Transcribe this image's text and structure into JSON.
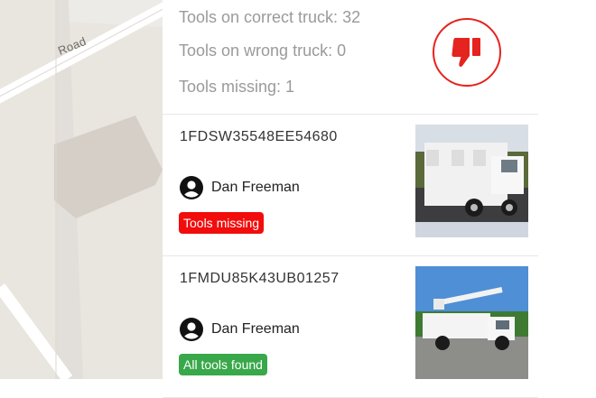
{
  "map": {
    "road_label": "Road"
  },
  "summary": {
    "correct": "Tools on correct truck: 32",
    "wrong": "Tools on wrong truck: 0",
    "missing": "Tools missing: 1",
    "feedback_icon": "thumbs-down-icon",
    "accent": "#e5231f"
  },
  "trucks": [
    {
      "vin": "1FDSW35548EE54680",
      "driver": "Dan Freeman",
      "status": "Tools missing",
      "status_color": "#f20c0c",
      "image": "utility-service-truck"
    },
    {
      "vin": "1FMDU85K43UB01257",
      "driver": "Dan Freeman",
      "status": "All tools found",
      "status_color": "#39a84a",
      "image": "bucket-truck"
    }
  ]
}
